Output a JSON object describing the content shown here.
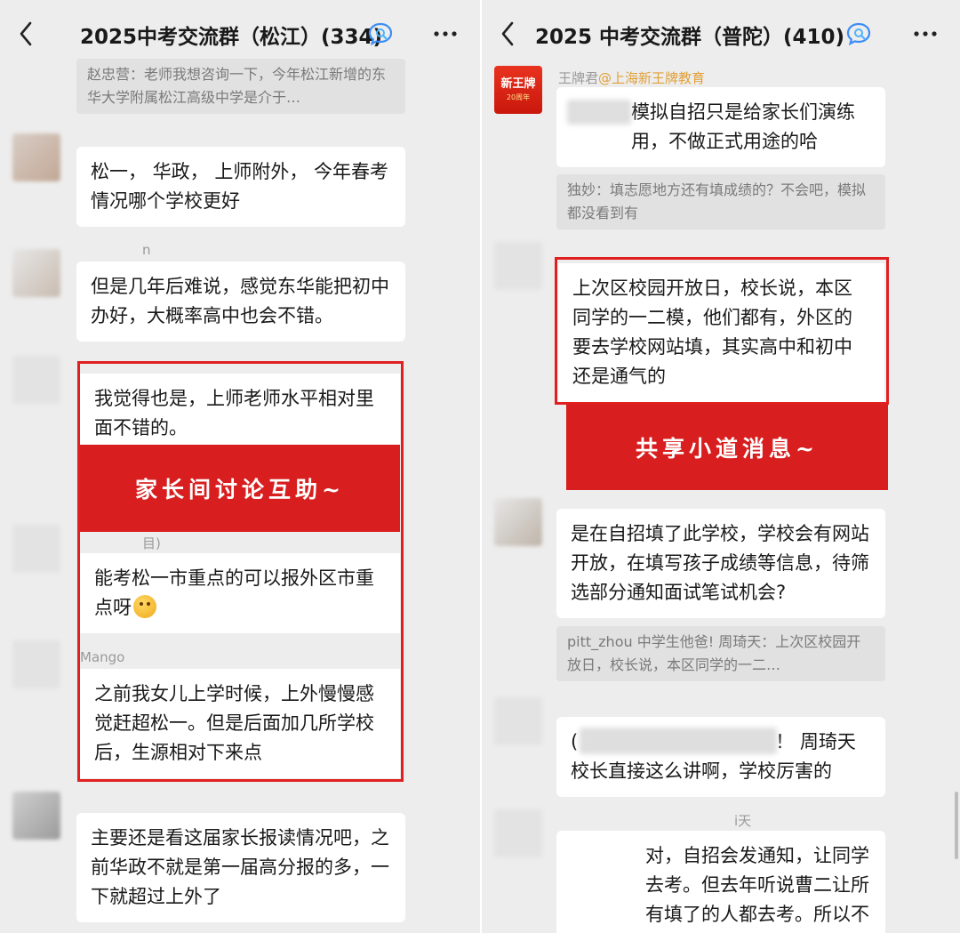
{
  "left": {
    "title": "2025中考交流群（松江）(334)",
    "quote_top": "赵忠营：老师我想咨询一下，今年松江新增的东华大学附属松江高级中学是介于…",
    "msg1": "松一， 华政， 上师附外， 今年春考情况哪个学校更好",
    "sender2": "n",
    "msg2": "但是几年后难说，感觉东华能把初中办好，大概率高中也会不错。",
    "msg3": "我觉得也是，上师老师水平相对里面不错的。",
    "banner": "家长间讨论互助~",
    "sender4": "目)",
    "msg4": "能考松一市重点的可以报外区市重点呀",
    "sender5": "Mango",
    "msg5": "之前我女儿上学时候，上外慢慢感觉赶超松一。但是后面加几所学校后，生源相对下来点",
    "msg6": "主要还是看这届家长报读情况吧，之前华政不就是第一届高分报的多，一下就超过上外了"
  },
  "right": {
    "title": "2025 中考交流群（普陀）(410)",
    "logo_text": "新王牌",
    "logo_sub": "20周年",
    "sender1_name": "王牌君",
    "sender1_org": "@上海新王牌教育",
    "msg1": "模拟自招只是给家长们演练用，不做正式用途的哈",
    "quote1": "独妙：填志愿地方还有填成绩的？不会吧，模拟都没看到有",
    "msg2": "上次区校园开放日，校长说，本区同学的一二模，他们都有，外区的要去学校网站填，其实高中和初中还是通气的",
    "banner": "共享小道消息~",
    "msg3": "是在自招填了此学校，学校会有网站开放，在填写孩子成绩等信息，待筛选部分通知面试笔试机会?",
    "quote2": "pitt_zhou 中学生他爸! 周琦天：上次区校园开放日，校长说，本区同学的一二…",
    "msg4_head": "(",
    "msg4_tail": "！ 周琦天",
    "msg4_line2": "校长直接这么讲啊，学校厉害的",
    "sender5": "i天",
    "msg5": "对，自招会发通知，让同学去考。但去年听说曹二让所有填了的人都去考。所以不绝对，看学校安排"
  },
  "icons": {
    "back": "chevron-left-icon",
    "badge": "chat-search-icon",
    "more": "more-dots-icon"
  },
  "colors": {
    "background": "#ededed",
    "bubble": "#ffffff",
    "highlight": "#e02020",
    "banner": "#d81e1e",
    "badge": "#3b8cf5"
  }
}
